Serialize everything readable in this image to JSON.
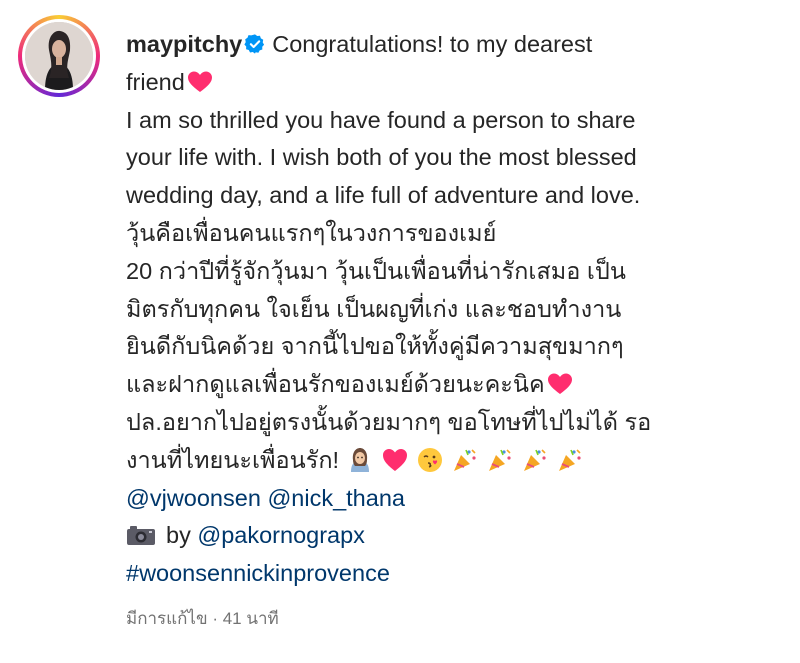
{
  "post": {
    "username": "maypitchy",
    "caption_lines": [
      "Congratulations! to my dearest",
      "friend",
      "I am so thrilled you have found a person to share",
      "your life with. I wish both of you the most blessed",
      "wedding day, and a life full of adventure and love.",
      "วุ้นคือเพื่อนคนแรกๆในวงการของเมย์",
      "20 กว่าปีที่รู้จักวุ้นมา วุ้นเป็นเพื่อนที่น่ารักเสมอ เป็น",
      "มิตรกับทุกคน ใจเย็น เป็นผญที่เก่ง และชอบทำงาน",
      "ยินดีกับนิคด้วย จากนี้ไปขอให้ทั้งคู่มีความสุขมากๆ",
      "และฝากดูแลเพื่อนรักของเมย์ด้วยนะคะนิค",
      "ปล.อยากไปอยู่ตรงนั้นด้วยมากๆ ขอโทษที่ไปไม่ได้ รอ",
      "งานที่ไทยนะเพื่อนรัก!"
    ],
    "mentions": [
      "@vjwoonsen",
      "@nick_thana"
    ],
    "photo_credit_prefix": "by",
    "photo_credit_handle": "@pakornograpx",
    "hashtag": "#woonsennickinprovence",
    "meta": "มีการแก้ไข · 41 นาที"
  },
  "icons": {
    "verified": "verified-badge-icon",
    "heart": "pink-heart-emoji",
    "camera": "camera-emoji",
    "emoji_sequence": [
      "woman-emoji",
      "pink-heart-emoji",
      "kissing-face-emoji",
      "party-popper-emoji",
      "party-popper-emoji",
      "party-popper-emoji",
      "party-popper-emoji"
    ]
  },
  "colors": {
    "text": "#262626",
    "link": "#00376b",
    "verified": "#0095f6",
    "heart": "#ff2d6e",
    "meta": "#737373"
  }
}
